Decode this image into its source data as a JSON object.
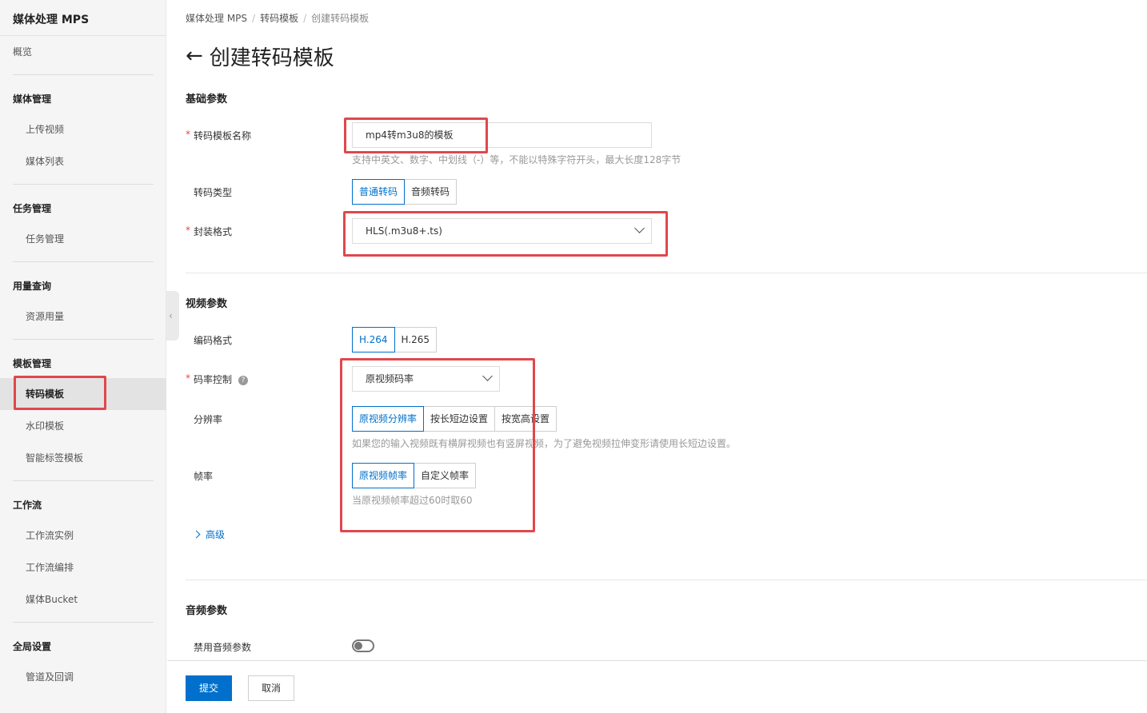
{
  "sidebar": {
    "app_title": "媒体处理 MPS",
    "overview": "概览",
    "groups": [
      {
        "title": "媒体管理",
        "items": [
          "上传视频",
          "媒体列表"
        ]
      },
      {
        "title": "任务管理",
        "items": [
          "任务管理"
        ]
      },
      {
        "title": "用量查询",
        "items": [
          "资源用量"
        ]
      },
      {
        "title": "模板管理",
        "items": [
          "转码模板",
          "水印模板",
          "智能标签模板"
        ]
      },
      {
        "title": "工作流",
        "items": [
          "工作流实例",
          "工作流编排",
          "媒体Bucket"
        ]
      },
      {
        "title": "全局设置",
        "items": [
          "管道及回调"
        ]
      }
    ],
    "active_item": "转码模板"
  },
  "breadcrumb": [
    "媒体处理 MPS",
    "转码模板",
    "创建转码模板"
  ],
  "page_title": "创建转码模板",
  "basic": {
    "section_title": "基础参数",
    "name_label": "转码模板名称",
    "name_value": "mp4转m3u8的模板",
    "name_hint": "支持中英文、数字、中划线（-）等，不能以特殊字符开头，最大长度128字节",
    "type_label": "转码类型",
    "type_options": [
      "普通转码",
      "音频转码"
    ],
    "type_selected": "普通转码",
    "container_label": "封装格式",
    "container_value": "HLS(.m3u8+.ts)"
  },
  "video": {
    "section_title": "视频参数",
    "codec_label": "编码格式",
    "codec_options": [
      "H.264",
      "H.265"
    ],
    "codec_selected": "H.264",
    "bitrate_label": "码率控制",
    "bitrate_value": "原视频码率",
    "resolution_label": "分辨率",
    "resolution_options": [
      "原视频分辨率",
      "按长短边设置",
      "按宽高设置"
    ],
    "resolution_selected": "原视频分辨率",
    "resolution_hint": "如果您的输入视频既有横屏视频也有竖屏视频，为了避免视频拉伸变形请使用长短边设置。",
    "framerate_label": "帧率",
    "framerate_options": [
      "原视频帧率",
      "自定义帧率"
    ],
    "framerate_selected": "原视频帧率",
    "framerate_hint": "当原视频帧率超过60时取60",
    "advanced_label": "高级"
  },
  "audio": {
    "section_title": "音频参数",
    "disable_label": "禁用音频参数",
    "disable_on": false
  },
  "footer": {
    "submit": "提交",
    "cancel": "取消"
  },
  "colors": {
    "primary": "#0070cc",
    "annotation": "#e0474c",
    "required": "#e44444"
  }
}
